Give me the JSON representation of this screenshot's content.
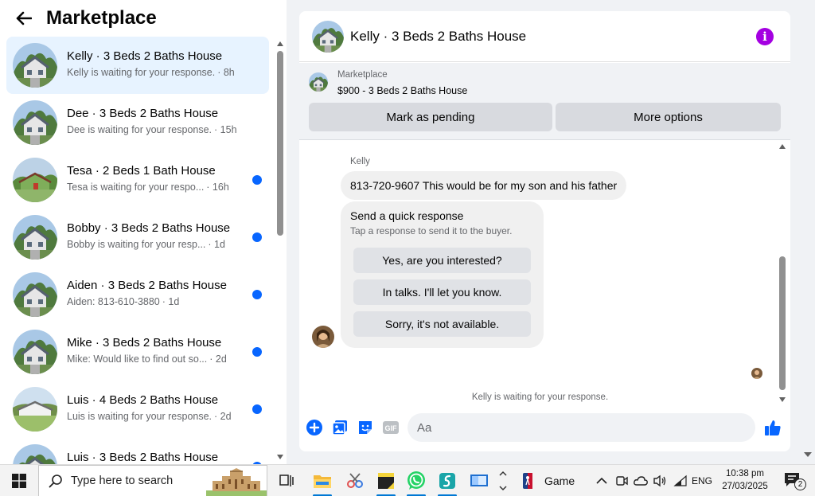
{
  "sidebar": {
    "title": "Marketplace",
    "conversations": [
      {
        "name": "Kelly · 3 Beds 2 Baths House",
        "snippet": "Kelly is waiting for your response.",
        "time": "· 8h",
        "unread": false,
        "active": true,
        "avatar": "house-photo"
      },
      {
        "name": "Dee · 3 Beds 2 Baths House",
        "snippet": "Dee is waiting for your response.",
        "time": "· 15h",
        "unread": false,
        "active": false,
        "avatar": "house-photo"
      },
      {
        "name": "Tesa · 2 Beds 1 Bath House",
        "snippet": "Tesa is waiting for your respo...",
        "time": "· 16h",
        "unread": true,
        "active": false,
        "avatar": "green-house-photo"
      },
      {
        "name": "Bobby · 3 Beds 2 Baths House",
        "snippet": "Bobby is waiting for your resp...",
        "time": "· 1d",
        "unread": true,
        "active": false,
        "avatar": "house-photo"
      },
      {
        "name": "Aiden · 3 Beds 2 Baths House",
        "snippet": "Aiden: 813-610-3880",
        "time": "· 1d",
        "unread": true,
        "active": false,
        "avatar": "house-photo"
      },
      {
        "name": "Mike · 3 Beds 2 Baths House",
        "snippet": "Mike: Would like to find out so...",
        "time": "· 2d",
        "unread": true,
        "active": false,
        "avatar": "house-photo"
      },
      {
        "name": "Luis · 4 Beds 2 Baths House",
        "snippet": "Luis is waiting for your response.",
        "time": "· 2d",
        "unread": true,
        "active": false,
        "avatar": "field-house-photo"
      },
      {
        "name": "Luis · 3 Beds 2 Baths House",
        "snippet": "",
        "time": "",
        "unread": true,
        "active": false,
        "avatar": "house-photo"
      }
    ]
  },
  "chat": {
    "title": "Kelly · 3 Beds 2 Baths House",
    "listing_source": "Marketplace",
    "listing_price": "$900 - 3 Beds 2 Baths House",
    "mark_pending_label": "Mark as pending",
    "more_options_label": "More options",
    "sender_name": "Kelly",
    "message": "813-720-9607 This would be for my son and his father",
    "quick_title": "Send a quick response",
    "quick_subtitle": "Tap a response to send it to the buyer.",
    "quick_responses": [
      "Yes, are you interested?",
      "In talks. I'll let you know.",
      "Sorry, it's not available."
    ],
    "status": "Kelly is waiting for your response.",
    "composer_placeholder": "Aa"
  },
  "taskbar": {
    "search_placeholder": "Type here to search",
    "weather_label": "Game",
    "language": "ENG",
    "time": "10:38 pm",
    "date": "27/03/2025",
    "notification_count": "2"
  },
  "colors": {
    "accent": "#0866ff",
    "info": "#a400e1",
    "active_row": "#e7f3ff"
  }
}
